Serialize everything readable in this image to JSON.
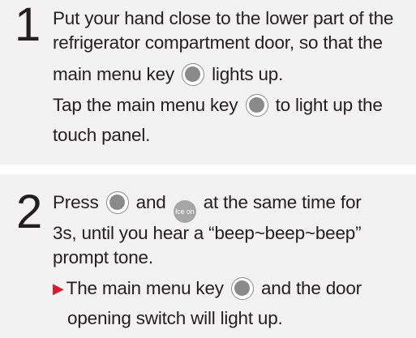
{
  "steps": [
    {
      "number": "1",
      "lines": [
        {
          "text": "Put your hand close to the lower part of the"
        },
        {
          "text": "refrigerator compartment door, so that the"
        },
        {
          "before": "main menu key",
          "after": "lights up."
        },
        {
          "before": "Tap the main menu key",
          "after": "to light up the"
        },
        {
          "text": "touch panel."
        }
      ]
    },
    {
      "number": "2",
      "lines": [
        {
          "before": "Press",
          "middle": "and",
          "after": "at the same time for"
        },
        {
          "text": "3s, until you hear a “beep~beep~beep”"
        },
        {
          "text": "prompt tone."
        },
        {
          "bullet": "▶",
          "before": "The main menu key",
          "after": "and the door"
        },
        {
          "text": "opening switch will light up."
        }
      ]
    }
  ],
  "ice_key": {
    "label": "Ice on"
  },
  "colors": {
    "block_background": "#f2f2f2",
    "key_gray": "#8a8a8a",
    "ice_badge": "#a6a6a6",
    "bullet_red": "#d81a2d",
    "text": "#231f20"
  },
  "icons": {
    "main_menu_key": "gray-circle-button-icon",
    "ice_key": "ice-on-button-icon",
    "bullet": "red-triangle-bullet-icon"
  }
}
